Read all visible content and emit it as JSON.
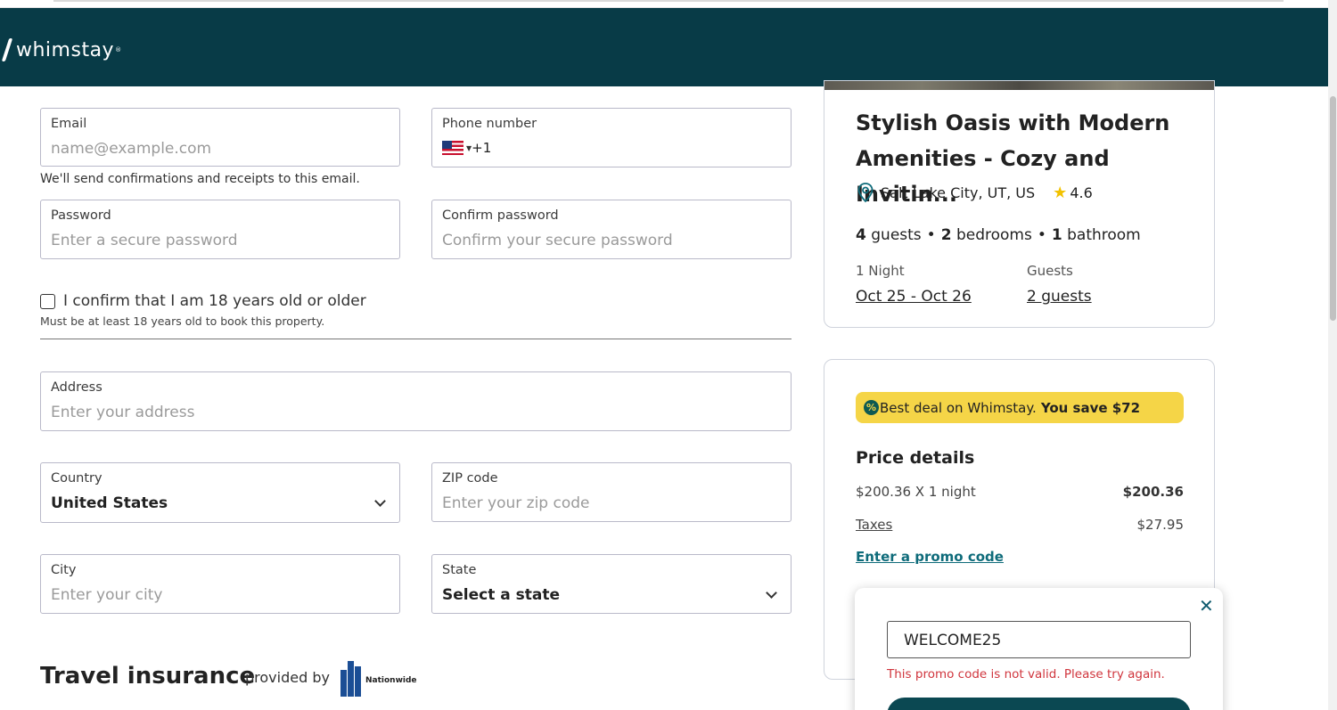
{
  "header": {
    "logo_text": "whimstay",
    "logo_reg": "®",
    "bg_color": "#083b47"
  },
  "form": {
    "email": {
      "label": "Email",
      "placeholder": "name@example.com",
      "helper": "We'll send confirmations and receipts to this email."
    },
    "phone": {
      "label": "Phone number",
      "country_code": "+1",
      "flag": "us-flag-icon"
    },
    "password": {
      "label": "Password",
      "placeholder": "Enter a secure password"
    },
    "confirm_password": {
      "label": "Confirm password",
      "placeholder": "Confirm your secure password"
    },
    "age_check": {
      "label": "I confirm that I am 18 years old or older",
      "note": "Must be at least 18 years old to book this property.",
      "checked": false
    },
    "address": {
      "label": "Address",
      "placeholder": "Enter your address"
    },
    "country": {
      "label": "Country",
      "value": "United States"
    },
    "zip": {
      "label": "ZIP code",
      "placeholder": "Enter your zip code"
    },
    "city": {
      "label": "City",
      "placeholder": "Enter your city"
    },
    "state": {
      "label": "State",
      "value": "Select a state"
    }
  },
  "insurance": {
    "title": "Travel insurance",
    "provided_by": "provided by",
    "provider": "Nationwide"
  },
  "property": {
    "title": "Stylish Oasis with Modern Amenities - Cozy and Invitin...",
    "location": "Salt Lake City, UT, US",
    "rating": "4.6",
    "guests_num": "4",
    "guests_word": "guests",
    "bedrooms_num": "2",
    "bedrooms_word": "bedrooms",
    "bathrooms_num": "1",
    "bathrooms_word": "bathroom",
    "nights_label": "1 Night",
    "dates": "Oct 25 - Oct 26",
    "guests_label": "Guests",
    "guests_value": "2 guests"
  },
  "pricing": {
    "deal_text": "Best deal on Whimstay.",
    "deal_save": "You save $72",
    "title": "Price details",
    "nightly_label": "$200.36 X 1 night",
    "nightly_amount": "$200.36",
    "taxes_label": "Taxes",
    "taxes_amount": "$27.95",
    "promo_link": "Enter a promo code"
  },
  "promo_popup": {
    "code_value": "WELCOME25",
    "error": "This promo code is not valid. Please try again.",
    "close_icon": "close-icon"
  }
}
